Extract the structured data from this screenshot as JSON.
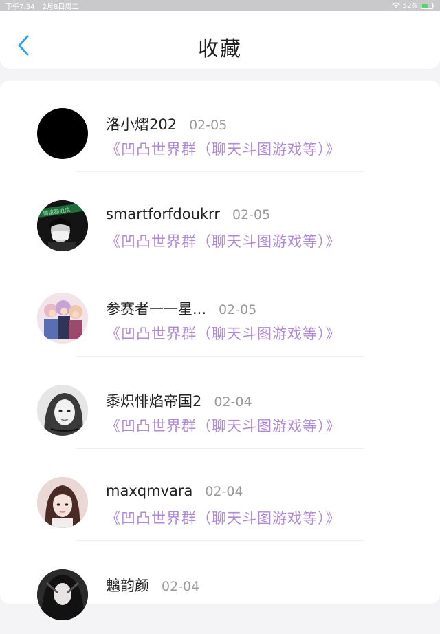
{
  "status_bar": {
    "time": "下午7:34",
    "date": "2月8日周二",
    "battery": "52%"
  },
  "header": {
    "title": "收藏"
  },
  "items": [
    {
      "name": "洛小熠202",
      "date": "02-05",
      "group": "《凹凸世界群（聊天斗图游戏等）》",
      "avatar": "black-avatar"
    },
    {
      "name": "smartforfdoukrr",
      "date": "02-05",
      "group": "《凹凸世界群（聊天斗图游戏等）》",
      "avatar": "masked-person-avatar",
      "avatar_text": "情谊都浪浪"
    },
    {
      "name": "参赛者一一星...",
      "date": "02-05",
      "group": "《凹凸世界群（聊天斗图游戏等）》",
      "avatar": "anime-group-avatar"
    },
    {
      "name": "黍炽悱焰帝国2",
      "date": "02-04",
      "group": "《凹凸世界群（聊天斗图游戏等）》",
      "avatar": "grayscale-portrait-avatar"
    },
    {
      "name": "maxqmvara",
      "date": "02-04",
      "group": "《凹凸世界群（聊天斗图游戏等）》",
      "avatar": "girl-portrait-avatar"
    },
    {
      "name": "魑韵颜",
      "date": "02-04",
      "group": "",
      "avatar": "dark-anime-avatar"
    }
  ]
}
